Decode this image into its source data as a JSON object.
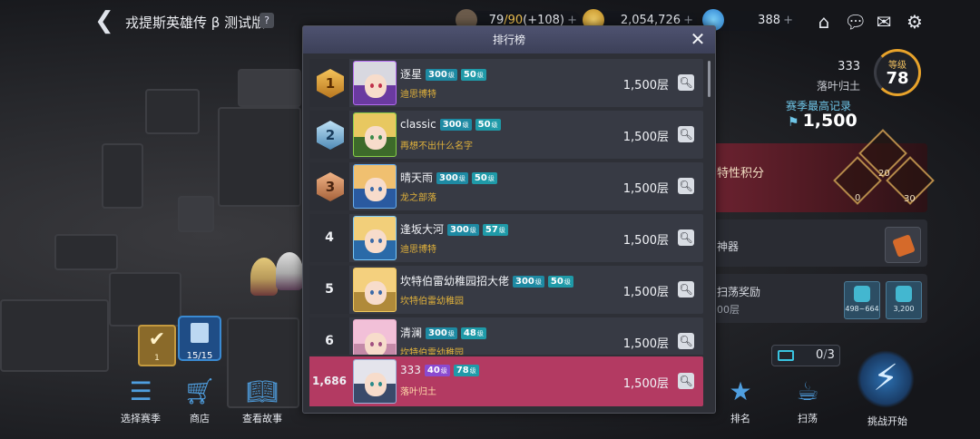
{
  "header": {
    "back_icon": "back-chevron-icon",
    "title": "戎提斯英雄传 β 测试版",
    "help": "?"
  },
  "resources": [
    {
      "icon": "coffee-cup-icon",
      "current": "79",
      "max": "/90",
      "bonus": "(+108)",
      "plus": "+"
    },
    {
      "icon": "gold-coin-icon",
      "value": "2,054,726",
      "plus": "+"
    },
    {
      "icon": "blue-gem-icon",
      "value": "388",
      "plus": "+"
    }
  ],
  "top_icons": [
    "guild-icon",
    "chat-icon",
    "mail-icon",
    "settings-gear-icon"
  ],
  "leaderboard": {
    "title": "排行榜",
    "close": "✕",
    "rows": [
      {
        "rank": "1",
        "medal": "gold",
        "name": "逐星",
        "badge1": "300",
        "badge1_unit": "级",
        "badge2": "50",
        "badge2_unit": "级",
        "guild": "迪思博特",
        "floors": "1,500层"
      },
      {
        "rank": "2",
        "medal": "silver",
        "name": "classic",
        "badge1": "300",
        "badge1_unit": "级",
        "badge2": "50",
        "badge2_unit": "级",
        "guild": "再想不出什么名字",
        "floors": "1,500层"
      },
      {
        "rank": "3",
        "medal": "bronze",
        "name": "晴天雨",
        "badge1": "300",
        "badge1_unit": "级",
        "badge2": "50",
        "badge2_unit": "级",
        "guild": "龙之部落",
        "floors": "1,500层"
      },
      {
        "rank": "4",
        "medal": "",
        "name": "逢坂大河",
        "badge1": "300",
        "badge1_unit": "级",
        "badge2": "57",
        "badge2_unit": "级",
        "guild": "迪思博特",
        "floors": "1,500层"
      },
      {
        "rank": "5",
        "medal": "",
        "name": "坎特伯雷幼稚园招大佬",
        "badge1": "300",
        "badge1_unit": "级",
        "badge2": "50",
        "badge2_unit": "级",
        "guild": "坎特伯雷幼稚园",
        "floors": "1,500层"
      },
      {
        "rank": "6",
        "medal": "",
        "name": "清澜",
        "badge1": "300",
        "badge1_unit": "级",
        "badge2": "48",
        "badge2_unit": "级",
        "guild": "坎特伯雷幼稚园",
        "floors": "1,500层"
      }
    ],
    "my_row": {
      "rank": "1,686",
      "name": "333",
      "badge1": "40",
      "badge1_unit": "级",
      "badge2": "78",
      "badge2_unit": "级",
      "guild": "落叶归土",
      "floors": "1,500层"
    },
    "search_icon": "magnifier-icon"
  },
  "player": {
    "name": "333",
    "guild": "落叶归土",
    "level_label": "等级",
    "level": "78",
    "season_best_label": "赛季最高记录",
    "season_best": "1,500"
  },
  "right_panel": {
    "attribute_label": "特性积分",
    "emblem_values": [
      "20",
      "0",
      "30"
    ],
    "weapon_label": "神器",
    "reward_label": "扫荡奖励",
    "reward_sub": "00层",
    "reward_items": [
      "498~664",
      "3,200"
    ]
  },
  "ticket": {
    "current": "0",
    "max": "3"
  },
  "bottom_nav": [
    {
      "label": "选择赛季",
      "icon": "books-icon"
    },
    {
      "label": "商店",
      "icon": "cart-icon"
    },
    {
      "label": "查看故事",
      "icon": "open-book-icon"
    },
    {
      "label": "排名",
      "icon": "podium-icon"
    },
    {
      "label": "扫荡",
      "icon": "tea-cup-icon"
    },
    {
      "label": "挑战开始",
      "icon": "lightning-icon"
    }
  ],
  "left_slots": {
    "check_count": "1",
    "book_count": "15/15"
  },
  "colors": {
    "my_row_bg": "#b33a62",
    "level_badge": "#1e8aa3",
    "guild_text": "#e0b13b",
    "gold": "#f3c552"
  }
}
